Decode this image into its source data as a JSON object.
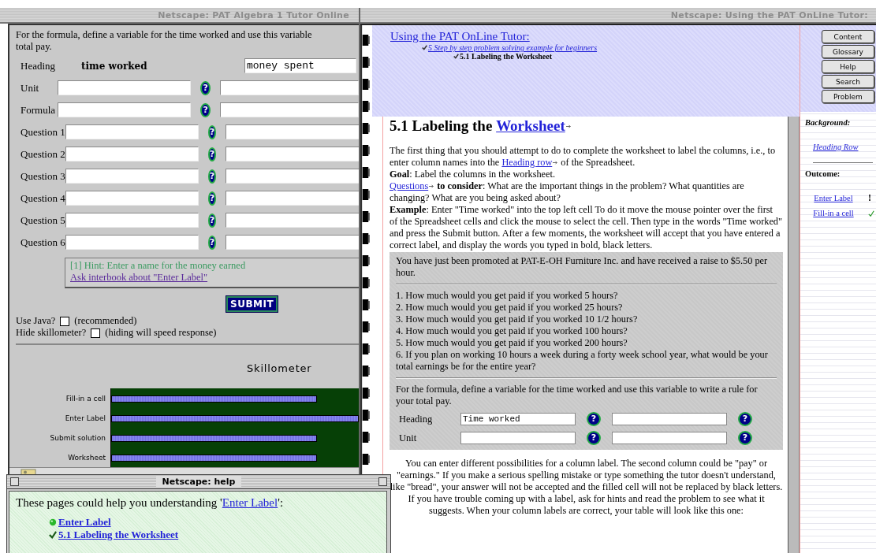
{
  "tutor_window": {
    "title": "Netscape: PAT Algebra 1 Tutor Online",
    "intro_lines": [
      "For the formula, define a variable for the time worked and use this variable",
      "total pay."
    ],
    "rows": [
      {
        "label": "Heading",
        "kind": "heading",
        "value": "time worked",
        "value_2": "money spent"
      },
      {
        "label": "Unit",
        "kind": "input",
        "help": "?"
      },
      {
        "label": "Formula",
        "kind": "input",
        "help": "?"
      },
      {
        "label": "Question 1",
        "kind": "input",
        "help": "?"
      },
      {
        "label": "Question 2",
        "kind": "input",
        "help": "?"
      },
      {
        "label": "Question 3",
        "kind": "input",
        "help": "?"
      },
      {
        "label": "Question 4",
        "kind": "input",
        "help": "?"
      },
      {
        "label": "Question 5",
        "kind": "input",
        "help": "?"
      },
      {
        "label": "Question 6",
        "kind": "input",
        "help": "?"
      }
    ],
    "hint": "[1] Hint: Enter a name for the money earned",
    "hint_link": "Ask interbook about \"Enter Label\"",
    "submit": "SUBMIT",
    "options": [
      {
        "label": "Use Java?",
        "checked": false,
        "note": "(recommended)"
      },
      {
        "label": "Hide skillometer?",
        "checked": false,
        "note": "(hiding will speed response)"
      }
    ],
    "skillometer": {
      "title": "Skillometer",
      "skills": [
        {
          "label": "Fill-in a cell",
          "level": 0.83
        },
        {
          "label": "Enter Label",
          "level": 1.0
        },
        {
          "label": "Submit solution",
          "level": 0.83
        },
        {
          "label": "Worksheet",
          "level": 0.83
        }
      ]
    }
  },
  "help_window": {
    "title": "Netscape: help",
    "intro": "These pages could help you understanding '",
    "intro_link": "Enter Label",
    "intro_end": "':",
    "links": [
      {
        "label": "Enter Label",
        "kind": "dot"
      },
      {
        "label": "5.1 Labeling the Worksheet",
        "kind": "check"
      }
    ]
  },
  "manual_window": {
    "title": "Netscape: Using the PAT OnLine Tutor:",
    "breadcrumbs": [
      {
        "label": "Using the PAT OnLine Tutor:",
        "kind": "root"
      },
      {
        "label": "5 Step by step problem solving example for beginners",
        "kind": "link"
      },
      {
        "label": "5.1 Labeling the Worksheet",
        "kind": "current"
      }
    ],
    "heading": "5.1 Labeling the ",
    "heading_link": "Worksheet",
    "paragraphs": [
      [
        {
          "text": "The first thing that you should attempt to do to complete the worksheet to label the columns, i.e., to enter column names into the ",
          "kind": "text"
        },
        {
          "text": "Heading row",
          "kind": "link"
        },
        {
          "text": " of the Spreadsheet.",
          "kind": "text"
        }
      ],
      [
        {
          "text": "Goal",
          "kind": "bold"
        },
        {
          "text": ":  Label the columns in the worksheet.",
          "kind": "text"
        }
      ],
      [
        {
          "text": "Questions",
          "kind": "link"
        },
        {
          "text": " to consider",
          "kind": "bold"
        },
        {
          "text": ":  What are the important things in the problem? What quantities are changing? What are you being asked about?",
          "kind": "text"
        }
      ],
      [
        {
          "text": "Example",
          "kind": "bold"
        },
        {
          "text": ":  Enter \"Time worked\" into the top left cell To do it move the mouse pointer over the first of the Spreadsheet cells and click the mouse to select the cell. Then type in the words \"Time worked\" and press the Submit button. After a few moments, the worksheet will accept that you have entered a correct label, and display the words you typed in bold, black letters.",
          "kind": "text"
        }
      ]
    ],
    "problem": {
      "intro": "You have just been promoted at PAT-E-OH Furniture Inc. and have received a raise to $5.50 per hour.",
      "questions": [
        "1. How much would you get paid if you worked 5 hours?",
        "2. How much would you get paid if you worked 25 hours?",
        "3. How much would you get paid if you worked 10 1/2 hours?",
        "4. How much would you get paid if you worked 100 hours?",
        "5. How much would you get paid if you worked 200 hours?",
        "6. If you plan on working 10 hours a week during a forty week school year, what would be your total earnings be for the entire year?"
      ],
      "formula": "For the formula, define a variable for the time worked and use this variable to write a rule for your total pay.",
      "rows": [
        {
          "label": "Heading",
          "cells": [
            {
              "value": "Time worked",
              "help": "?"
            },
            {
              "help": "?"
            }
          ]
        },
        {
          "label": "Unit",
          "cells": [
            {
              "help": "?"
            },
            {
              "help": "?"
            }
          ]
        }
      ]
    },
    "closing": "You can enter different possibilities for a column label.  The second column could be \"pay\" or \"earnings.\" If you make a serious spelling mistake or type something the tutor doesn't understand, like \"bread\", your answer will not be accepted and the filled cell will not be replaced by black letters. If you have trouble coming up with a label, ask for hints and read the problem to see what it suggests. When your column labels are correct, your table will look like this one:",
    "nav_buttons": [
      "Content",
      "Glossary",
      "Help",
      "Search",
      "Problem"
    ],
    "background_label": "Background:",
    "background_link": "Heading Row",
    "outcome_label": "Outcome:",
    "outcomes": [
      {
        "label": "Enter Label",
        "kind": "attention",
        "mark": "!"
      },
      {
        "label": "Fill-in a cell",
        "kind": "done"
      }
    ]
  }
}
